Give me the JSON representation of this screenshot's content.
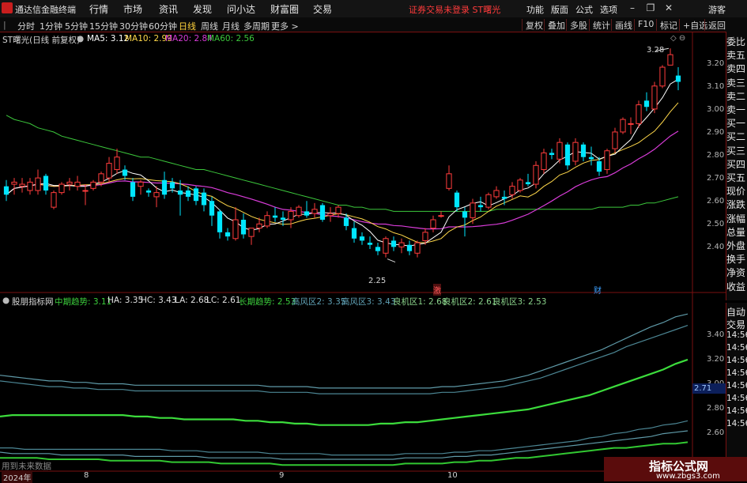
{
  "app": {
    "name": "通达信金融终端"
  },
  "main_menu": [
    "行情",
    "市场",
    "资讯",
    "发现",
    "问小达",
    "财富圈",
    "交易"
  ],
  "warning": "证券交易未登录  ST曙光",
  "right_menu": [
    "功能",
    "版面",
    "公式",
    "选项",
    "游客"
  ],
  "periods": [
    "分时",
    "1分钟",
    "5分钟",
    "15分钟",
    "30分钟",
    "60分钟",
    "日线",
    "周线",
    "月线",
    "多周期",
    "更多 >"
  ],
  "active_period": "日线",
  "tools": [
    "复权",
    "叠加",
    "多股",
    "统计",
    "画线",
    "F10",
    "标记",
    "+自选",
    "返回"
  ],
  "colors": {
    "up": "#ff3c3c",
    "down": "#00e6ff",
    "ma5": "#ffffff",
    "ma10": "#ffd84a",
    "ma20": "#d93cd9",
    "ma60": "#3cc83c"
  },
  "main_legend": {
    "title": "ST曙光(日线 前复权)",
    "ma5": "MA5: 3.12",
    "ma10": "MA10: 2.99",
    "ma20": "MA20: 2.84",
    "ma60": "MA60: 2.56"
  },
  "price_axis": [
    "3.20",
    "3.10",
    "3.00",
    "2.90",
    "2.80",
    "2.70",
    "2.60",
    "2.50",
    "2.40"
  ],
  "annotations": {
    "high": "3.28",
    "low": "2.25",
    "mark_ji": "激",
    "mark_cai": "财"
  },
  "indicator_legend": {
    "name": "股朋指标网",
    "items": [
      "中期趋势: 3.11",
      "HA: 3.35",
      "HC: 3.43",
      "LA: 2.68",
      "LC: 2.61",
      "长期趋势: 2.53",
      "高风区2: 3.35",
      "高风区3: 3.43",
      "良机区1: 2.68",
      "良机区2: 2.61",
      "良机区3: 2.53"
    ]
  },
  "indicator_axis": [
    "3.40",
    "3.20",
    "3.00",
    "2.80",
    "2.60"
  ],
  "indicator_cur": "2.71",
  "future_note": "用到未来数据",
  "dates": [
    "2024年",
    "8",
    "9",
    "10"
  ],
  "side_quote": [
    "委比",
    "卖五",
    "卖四",
    "卖三",
    "卖二",
    "卖一",
    "买一",
    "买二",
    "买三",
    "买四",
    "买五",
    "现价",
    "涨跌",
    "涨幅",
    "总量",
    "外盘",
    "换手",
    "净资",
    "收益"
  ],
  "side_trade": [
    "自动",
    "交易",
    "14:56",
    "14:56",
    "14:56",
    "14:56",
    "14:56",
    "14:56",
    "14:56",
    "14:56"
  ],
  "watermark": {
    "title": "指标公式网",
    "url": "www.zbgs3.com"
  },
  "chart_data": [
    {
      "type": "candlestick",
      "title": "ST曙光(日线 前复权)",
      "ylim": [
        2.18,
        3.33
      ],
      "ohlc": [
        [
          2.62,
          2.65,
          2.55,
          2.58
        ],
        [
          2.63,
          2.66,
          2.58,
          2.64
        ],
        [
          2.62,
          2.66,
          2.59,
          2.63
        ],
        [
          2.6,
          2.66,
          2.58,
          2.64
        ],
        [
          2.6,
          2.7,
          2.58,
          2.66
        ],
        [
          2.67,
          2.68,
          2.58,
          2.6
        ],
        [
          2.52,
          2.6,
          2.51,
          2.59
        ],
        [
          2.59,
          2.64,
          2.58,
          2.63
        ],
        [
          2.63,
          2.66,
          2.6,
          2.64
        ],
        [
          2.62,
          2.67,
          2.6,
          2.64
        ],
        [
          2.6,
          2.63,
          2.53,
          2.6
        ],
        [
          2.61,
          2.65,
          2.6,
          2.64
        ],
        [
          2.64,
          2.69,
          2.62,
          2.68
        ],
        [
          2.66,
          2.76,
          2.64,
          2.73
        ],
        [
          2.7,
          2.8,
          2.68,
          2.76
        ],
        [
          2.7,
          2.72,
          2.65,
          2.67
        ],
        [
          2.64,
          2.66,
          2.55,
          2.57
        ],
        [
          2.62,
          2.65,
          2.58,
          2.64
        ],
        [
          2.6,
          2.61,
          2.57,
          2.59
        ],
        [
          2.57,
          2.62,
          2.52,
          2.59
        ],
        [
          2.65,
          2.69,
          2.56,
          2.58
        ],
        [
          2.64,
          2.66,
          2.59,
          2.61
        ],
        [
          2.6,
          2.65,
          2.48,
          2.58
        ],
        [
          2.6,
          2.62,
          2.55,
          2.57
        ],
        [
          2.61,
          2.62,
          2.53,
          2.55
        ],
        [
          2.59,
          2.61,
          2.5,
          2.53
        ],
        [
          2.55,
          2.57,
          2.43,
          2.48
        ],
        [
          2.5,
          2.51,
          2.37,
          2.4
        ],
        [
          2.4,
          2.42,
          2.36,
          2.38
        ],
        [
          2.37,
          2.52,
          2.36,
          2.46
        ],
        [
          2.46,
          2.49,
          2.37,
          2.39
        ],
        [
          2.38,
          2.42,
          2.34,
          2.42
        ],
        [
          2.42,
          2.47,
          2.4,
          2.44
        ],
        [
          2.43,
          2.5,
          2.42,
          2.48
        ],
        [
          2.48,
          2.52,
          2.45,
          2.47
        ],
        [
          2.47,
          2.5,
          2.43,
          2.46
        ],
        [
          2.46,
          2.52,
          2.42,
          2.5
        ],
        [
          2.48,
          2.53,
          2.47,
          2.52
        ],
        [
          2.5,
          2.55,
          2.47,
          2.48
        ],
        [
          2.49,
          2.54,
          2.47,
          2.51
        ],
        [
          2.53,
          2.54,
          2.45,
          2.46
        ],
        [
          2.48,
          2.52,
          2.45,
          2.49
        ],
        [
          2.49,
          2.53,
          2.47,
          2.52
        ],
        [
          2.47,
          2.49,
          2.41,
          2.43
        ],
        [
          2.42,
          2.45,
          2.35,
          2.37
        ],
        [
          2.38,
          2.4,
          2.34,
          2.36
        ],
        [
          2.35,
          2.38,
          2.32,
          2.34
        ],
        [
          2.33,
          2.35,
          2.29,
          2.31
        ],
        [
          2.3,
          2.38,
          2.28,
          2.37
        ],
        [
          2.36,
          2.38,
          2.31,
          2.33
        ],
        [
          2.33,
          2.37,
          2.3,
          2.35
        ],
        [
          2.34,
          2.36,
          2.29,
          2.31
        ],
        [
          2.3,
          2.36,
          2.28,
          2.35
        ],
        [
          2.36,
          2.42,
          2.34,
          2.4
        ],
        [
          2.42,
          2.48,
          2.4,
          2.46
        ],
        [
          2.48,
          2.5,
          2.47,
          2.48
        ],
        [
          2.61,
          2.72,
          2.6,
          2.68
        ],
        [
          2.59,
          2.6,
          2.5,
          2.52
        ],
        [
          2.5,
          2.52,
          2.38,
          2.47
        ],
        [
          2.47,
          2.56,
          2.44,
          2.54
        ],
        [
          2.53,
          2.57,
          2.5,
          2.52
        ],
        [
          2.52,
          2.59,
          2.51,
          2.58
        ],
        [
          2.57,
          2.62,
          2.56,
          2.6
        ],
        [
          2.57,
          2.6,
          2.53,
          2.56
        ],
        [
          2.58,
          2.64,
          2.56,
          2.62
        ],
        [
          2.6,
          2.66,
          2.59,
          2.65
        ],
        [
          2.64,
          2.68,
          2.62,
          2.63
        ],
        [
          2.63,
          2.74,
          2.61,
          2.72
        ],
        [
          2.7,
          2.8,
          2.68,
          2.78
        ],
        [
          2.78,
          2.8,
          2.75,
          2.77
        ],
        [
          2.75,
          2.85,
          2.73,
          2.83
        ],
        [
          2.82,
          2.83,
          2.7,
          2.72
        ],
        [
          2.74,
          2.85,
          2.72,
          2.83
        ],
        [
          2.82,
          2.83,
          2.74,
          2.76
        ],
        [
          2.76,
          2.81,
          2.72,
          2.75
        ],
        [
          2.74,
          2.76,
          2.67,
          2.69
        ],
        [
          2.7,
          2.8,
          2.68,
          2.79
        ],
        [
          2.8,
          2.9,
          2.78,
          2.88
        ],
        [
          2.88,
          2.95,
          2.87,
          2.94
        ],
        [
          2.92,
          2.95,
          2.87,
          2.92
        ],
        [
          2.92,
          3.03,
          2.9,
          3.01
        ],
        [
          3.03,
          3.07,
          2.98,
          3.0
        ],
        [
          2.99,
          3.12,
          2.97,
          3.1
        ],
        [
          3.1,
          3.2,
          3.09,
          3.19
        ],
        [
          3.2,
          3.28,
          3.2,
          3.25
        ],
        [
          3.15,
          3.19,
          3.08,
          3.12
        ]
      ],
      "series": [
        {
          "name": "MA5",
          "last": 3.12
        },
        {
          "name": "MA10",
          "last": 2.99
        },
        {
          "name": "MA20",
          "last": 2.84
        },
        {
          "name": "MA60",
          "last": 2.56
        }
      ],
      "ma60": [
        2.96,
        2.94,
        2.93,
        2.92,
        2.9,
        2.89,
        2.88,
        2.86,
        2.85,
        2.84,
        2.83,
        2.82,
        2.81,
        2.8,
        2.79,
        2.78,
        2.77,
        2.76,
        2.76,
        2.75,
        2.74,
        2.73,
        2.72,
        2.71,
        2.7,
        2.7,
        2.69,
        2.68,
        2.67,
        2.66,
        2.65,
        2.64,
        2.63,
        2.62,
        2.61,
        2.6,
        2.59,
        2.58,
        2.57,
        2.56,
        2.55,
        2.54,
        2.53,
        2.53,
        2.52,
        2.52,
        2.51,
        2.51,
        2.51,
        2.5,
        2.5,
        2.5,
        2.5,
        2.5,
        2.5,
        2.5,
        2.5,
        2.5,
        2.5,
        2.5,
        2.5,
        2.5,
        2.51,
        2.51,
        2.51,
        2.51,
        2.51,
        2.51,
        2.51,
        2.51,
        2.51,
        2.51,
        2.51,
        2.51,
        2.51,
        2.52,
        2.52,
        2.52,
        2.52,
        2.53,
        2.53,
        2.54,
        2.54,
        2.55,
        2.56,
        2.57
      ]
    },
    {
      "type": "line",
      "title": "股朋指标网",
      "ylim": [
        2.36,
        3.47
      ],
      "series": [
        {
          "name": "高风区3",
          "last": 3.43,
          "values": [
            3.0,
            2.99,
            2.98,
            2.97,
            2.96,
            2.96,
            2.95,
            2.95,
            2.94,
            2.94,
            2.94,
            2.93,
            2.93,
            2.93,
            2.93,
            2.93,
            2.93,
            2.93,
            2.93,
            2.93,
            2.93,
            2.93,
            2.92,
            2.92,
            2.92,
            2.92,
            2.91,
            2.91,
            2.91,
            2.91,
            2.91,
            2.91,
            2.91,
            2.91,
            2.91,
            2.91,
            2.92,
            2.92,
            2.93,
            2.94,
            2.95,
            2.96,
            2.98,
            3.0,
            3.03,
            3.06,
            3.09,
            3.12,
            3.15,
            3.18,
            3.22,
            3.26,
            3.3,
            3.34,
            3.37,
            3.41,
            3.43
          ]
        },
        {
          "name": "高风区2",
          "last": 3.35,
          "values": [
            2.96,
            2.95,
            2.94,
            2.93,
            2.92,
            2.92,
            2.91,
            2.91,
            2.9,
            2.9,
            2.9,
            2.89,
            2.89,
            2.89,
            2.89,
            2.89,
            2.89,
            2.89,
            2.89,
            2.89,
            2.89,
            2.89,
            2.88,
            2.88,
            2.88,
            2.88,
            2.87,
            2.87,
            2.87,
            2.87,
            2.87,
            2.87,
            2.87,
            2.87,
            2.87,
            2.87,
            2.88,
            2.88,
            2.89,
            2.9,
            2.91,
            2.92,
            2.94,
            2.96,
            2.98,
            3.01,
            3.04,
            3.07,
            3.1,
            3.13,
            3.16,
            3.2,
            3.23,
            3.26,
            3.29,
            3.32,
            3.35
          ]
        },
        {
          "name": "中期趋势",
          "last": 3.11,
          "values": [
            2.71,
            2.72,
            2.72,
            2.72,
            2.72,
            2.72,
            2.72,
            2.72,
            2.72,
            2.72,
            2.72,
            2.71,
            2.71,
            2.7,
            2.7,
            2.69,
            2.69,
            2.69,
            2.69,
            2.69,
            2.68,
            2.68,
            2.67,
            2.67,
            2.66,
            2.66,
            2.65,
            2.65,
            2.65,
            2.65,
            2.65,
            2.66,
            2.66,
            2.67,
            2.67,
            2.68,
            2.69,
            2.7,
            2.71,
            2.72,
            2.73,
            2.74,
            2.75,
            2.76,
            2.78,
            2.8,
            2.82,
            2.84,
            2.86,
            2.89,
            2.92,
            2.95,
            2.98,
            3.01,
            3.04,
            3.08,
            3.11
          ]
        },
        {
          "name": "良机区1",
          "last": 2.68,
          "values": [
            2.49,
            2.49,
            2.48,
            2.48,
            2.48,
            2.48,
            2.48,
            2.48,
            2.48,
            2.48,
            2.48,
            2.48,
            2.48,
            2.48,
            2.47,
            2.47,
            2.47,
            2.46,
            2.46,
            2.46,
            2.46,
            2.46,
            2.45,
            2.45,
            2.45,
            2.45,
            2.45,
            2.44,
            2.44,
            2.44,
            2.44,
            2.44,
            2.44,
            2.45,
            2.45,
            2.45,
            2.45,
            2.46,
            2.46,
            2.47,
            2.47,
            2.48,
            2.49,
            2.5,
            2.51,
            2.52,
            2.53,
            2.54,
            2.56,
            2.57,
            2.59,
            2.6,
            2.62,
            2.63,
            2.65,
            2.66,
            2.68
          ]
        },
        {
          "name": "良机区2",
          "last": 2.61,
          "values": [
            2.46,
            2.45,
            2.45,
            2.45,
            2.45,
            2.44,
            2.44,
            2.44,
            2.44,
            2.44,
            2.44,
            2.43,
            2.43,
            2.43,
            2.43,
            2.43,
            2.43,
            2.42,
            2.42,
            2.42,
            2.42,
            2.42,
            2.42,
            2.41,
            2.41,
            2.41,
            2.41,
            2.41,
            2.41,
            2.41,
            2.41,
            2.41,
            2.41,
            2.42,
            2.42,
            2.42,
            2.42,
            2.43,
            2.43,
            2.44,
            2.44,
            2.45,
            2.46,
            2.47,
            2.48,
            2.49,
            2.5,
            2.51,
            2.52,
            2.53,
            2.54,
            2.55,
            2.56,
            2.57,
            2.59,
            2.6,
            2.61
          ]
        },
        {
          "name": "长期趋势",
          "last": 2.53,
          "values": [
            2.42,
            2.42,
            2.42,
            2.42,
            2.41,
            2.41,
            2.41,
            2.41,
            2.41,
            2.4,
            2.4,
            2.4,
            2.4,
            2.4,
            2.39,
            2.39,
            2.39,
            2.39,
            2.38,
            2.38,
            2.38,
            2.38,
            2.38,
            2.37,
            2.37,
            2.37,
            2.37,
            2.37,
            2.37,
            2.37,
            2.37,
            2.37,
            2.37,
            2.38,
            2.38,
            2.38,
            2.38,
            2.39,
            2.39,
            2.4,
            2.4,
            2.41,
            2.42,
            2.42,
            2.43,
            2.44,
            2.45,
            2.46,
            2.47,
            2.48,
            2.49,
            2.49,
            2.5,
            2.51,
            2.52,
            2.52,
            2.53
          ]
        }
      ]
    }
  ]
}
